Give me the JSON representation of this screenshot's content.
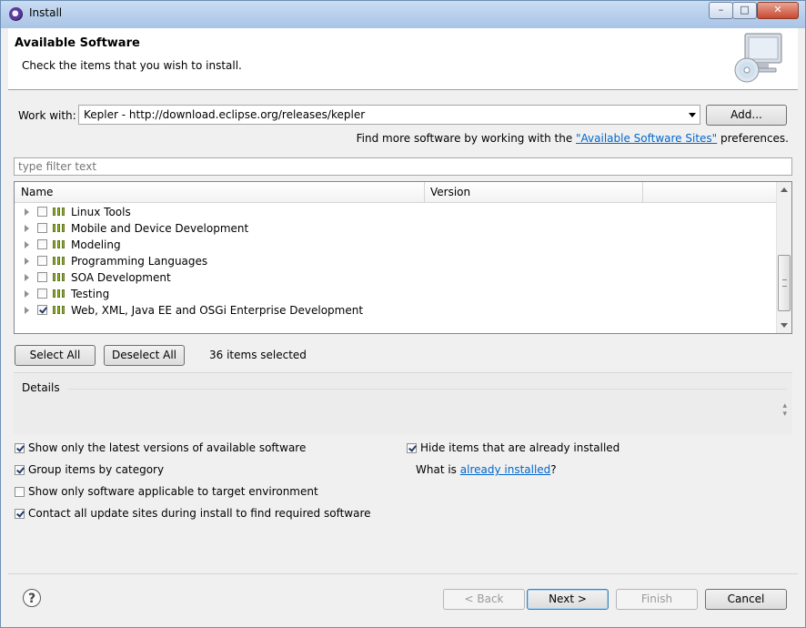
{
  "window": {
    "title": "Install",
    "min_glyph": "–",
    "max_glyph": "□",
    "close_glyph": "✕"
  },
  "header": {
    "title": "Available Software",
    "subtitle": "Check the items that you wish to install.",
    "icon": "monitor-cd-icon"
  },
  "work_with": {
    "label": "Work with:",
    "value": "Kepler - http://download.eclipse.org/releases/kepler",
    "add_button": "Add..."
  },
  "find_more": {
    "prefix": "Find more software by working with the ",
    "link": "\"Available Software Sites\"",
    "suffix": " preferences."
  },
  "filter": {
    "placeholder": "type filter text"
  },
  "tree": {
    "columns": [
      "Name",
      "Version"
    ],
    "rows": [
      {
        "label": "Linux Tools",
        "checked": false
      },
      {
        "label": "Mobile and Device Development",
        "checked": false
      },
      {
        "label": "Modeling",
        "checked": false
      },
      {
        "label": "Programming Languages",
        "checked": false
      },
      {
        "label": "SOA Development",
        "checked": false
      },
      {
        "label": "Testing",
        "checked": false
      },
      {
        "label": "Web, XML, Java EE and OSGi Enterprise Development",
        "checked": true
      }
    ]
  },
  "selection": {
    "select_all": "Select All",
    "deselect_all": "Deselect All",
    "count_text": "36 items selected"
  },
  "details": {
    "label": "Details"
  },
  "options": {
    "latest_versions": {
      "label": "Show only the latest versions of available software",
      "checked": true
    },
    "group_by_category": {
      "label": "Group items by category",
      "checked": true
    },
    "target_env": {
      "label": "Show only software applicable to target environment",
      "checked": false
    },
    "contact_sites": {
      "label": "Contact all update sites during install to find required software",
      "checked": true
    },
    "hide_installed": {
      "label": "Hide items that are already installed",
      "checked": true
    },
    "what_is_prefix": "What is ",
    "what_is_link": "already installed",
    "what_is_suffix": "?"
  },
  "footer": {
    "help": "?",
    "back": "< Back",
    "next": "Next >",
    "finish": "Finish",
    "cancel": "Cancel"
  }
}
